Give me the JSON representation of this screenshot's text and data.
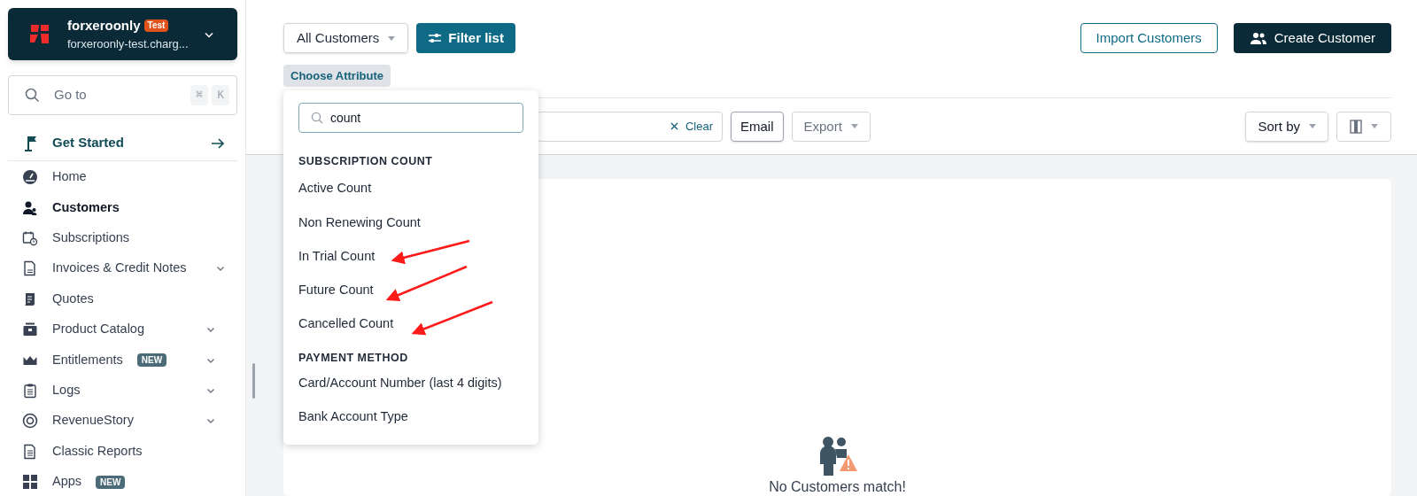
{
  "account": {
    "name": "forxeroonly",
    "badge": "Test",
    "domain": "forxeroonly-test.charg..."
  },
  "goto": {
    "placeholder": "Go to",
    "keys": [
      "⌘",
      "K"
    ]
  },
  "get_started": {
    "label": "Get Started"
  },
  "nav": [
    {
      "label": "Home",
      "selected": false,
      "expandable": false
    },
    {
      "label": "Customers",
      "selected": true,
      "expandable": false
    },
    {
      "label": "Subscriptions",
      "selected": false,
      "expandable": false
    },
    {
      "label": "Invoices & Credit Notes",
      "selected": false,
      "expandable": true
    },
    {
      "label": "Quotes",
      "selected": false,
      "expandable": false
    },
    {
      "label": "Product Catalog",
      "selected": false,
      "expandable": true
    },
    {
      "label": "Entitlements",
      "selected": false,
      "expandable": true,
      "badge": "NEW"
    },
    {
      "label": "Logs",
      "selected": false,
      "expandable": true
    },
    {
      "label": "RevenueStory",
      "selected": false,
      "expandable": true
    },
    {
      "label": "Classic Reports",
      "selected": false,
      "expandable": false
    },
    {
      "label": "Apps",
      "selected": false,
      "expandable": false,
      "badge": "NEW"
    }
  ],
  "toolbar": {
    "view_select": "All Customers",
    "filter_button": "Filter list",
    "import_button": "Import Customers",
    "create_button": "Create Customer",
    "choose_attribute": "Choose Attribute"
  },
  "search_row": {
    "clear": "Clear",
    "email": "Email",
    "export": "Export",
    "sort": "Sort by"
  },
  "attribute_menu": {
    "search_value": "count",
    "groups": [
      {
        "heading": "SUBSCRIPTION COUNT",
        "items": [
          "Active Count",
          "Non Renewing Count",
          "In Trial Count",
          "Future Count",
          "Cancelled Count"
        ]
      },
      {
        "heading": "PAYMENT METHOD",
        "items": [
          "Card/Account Number (last 4 digits)",
          "Bank Account Type"
        ]
      }
    ]
  },
  "empty_state": {
    "message": "No Customers match!"
  }
}
